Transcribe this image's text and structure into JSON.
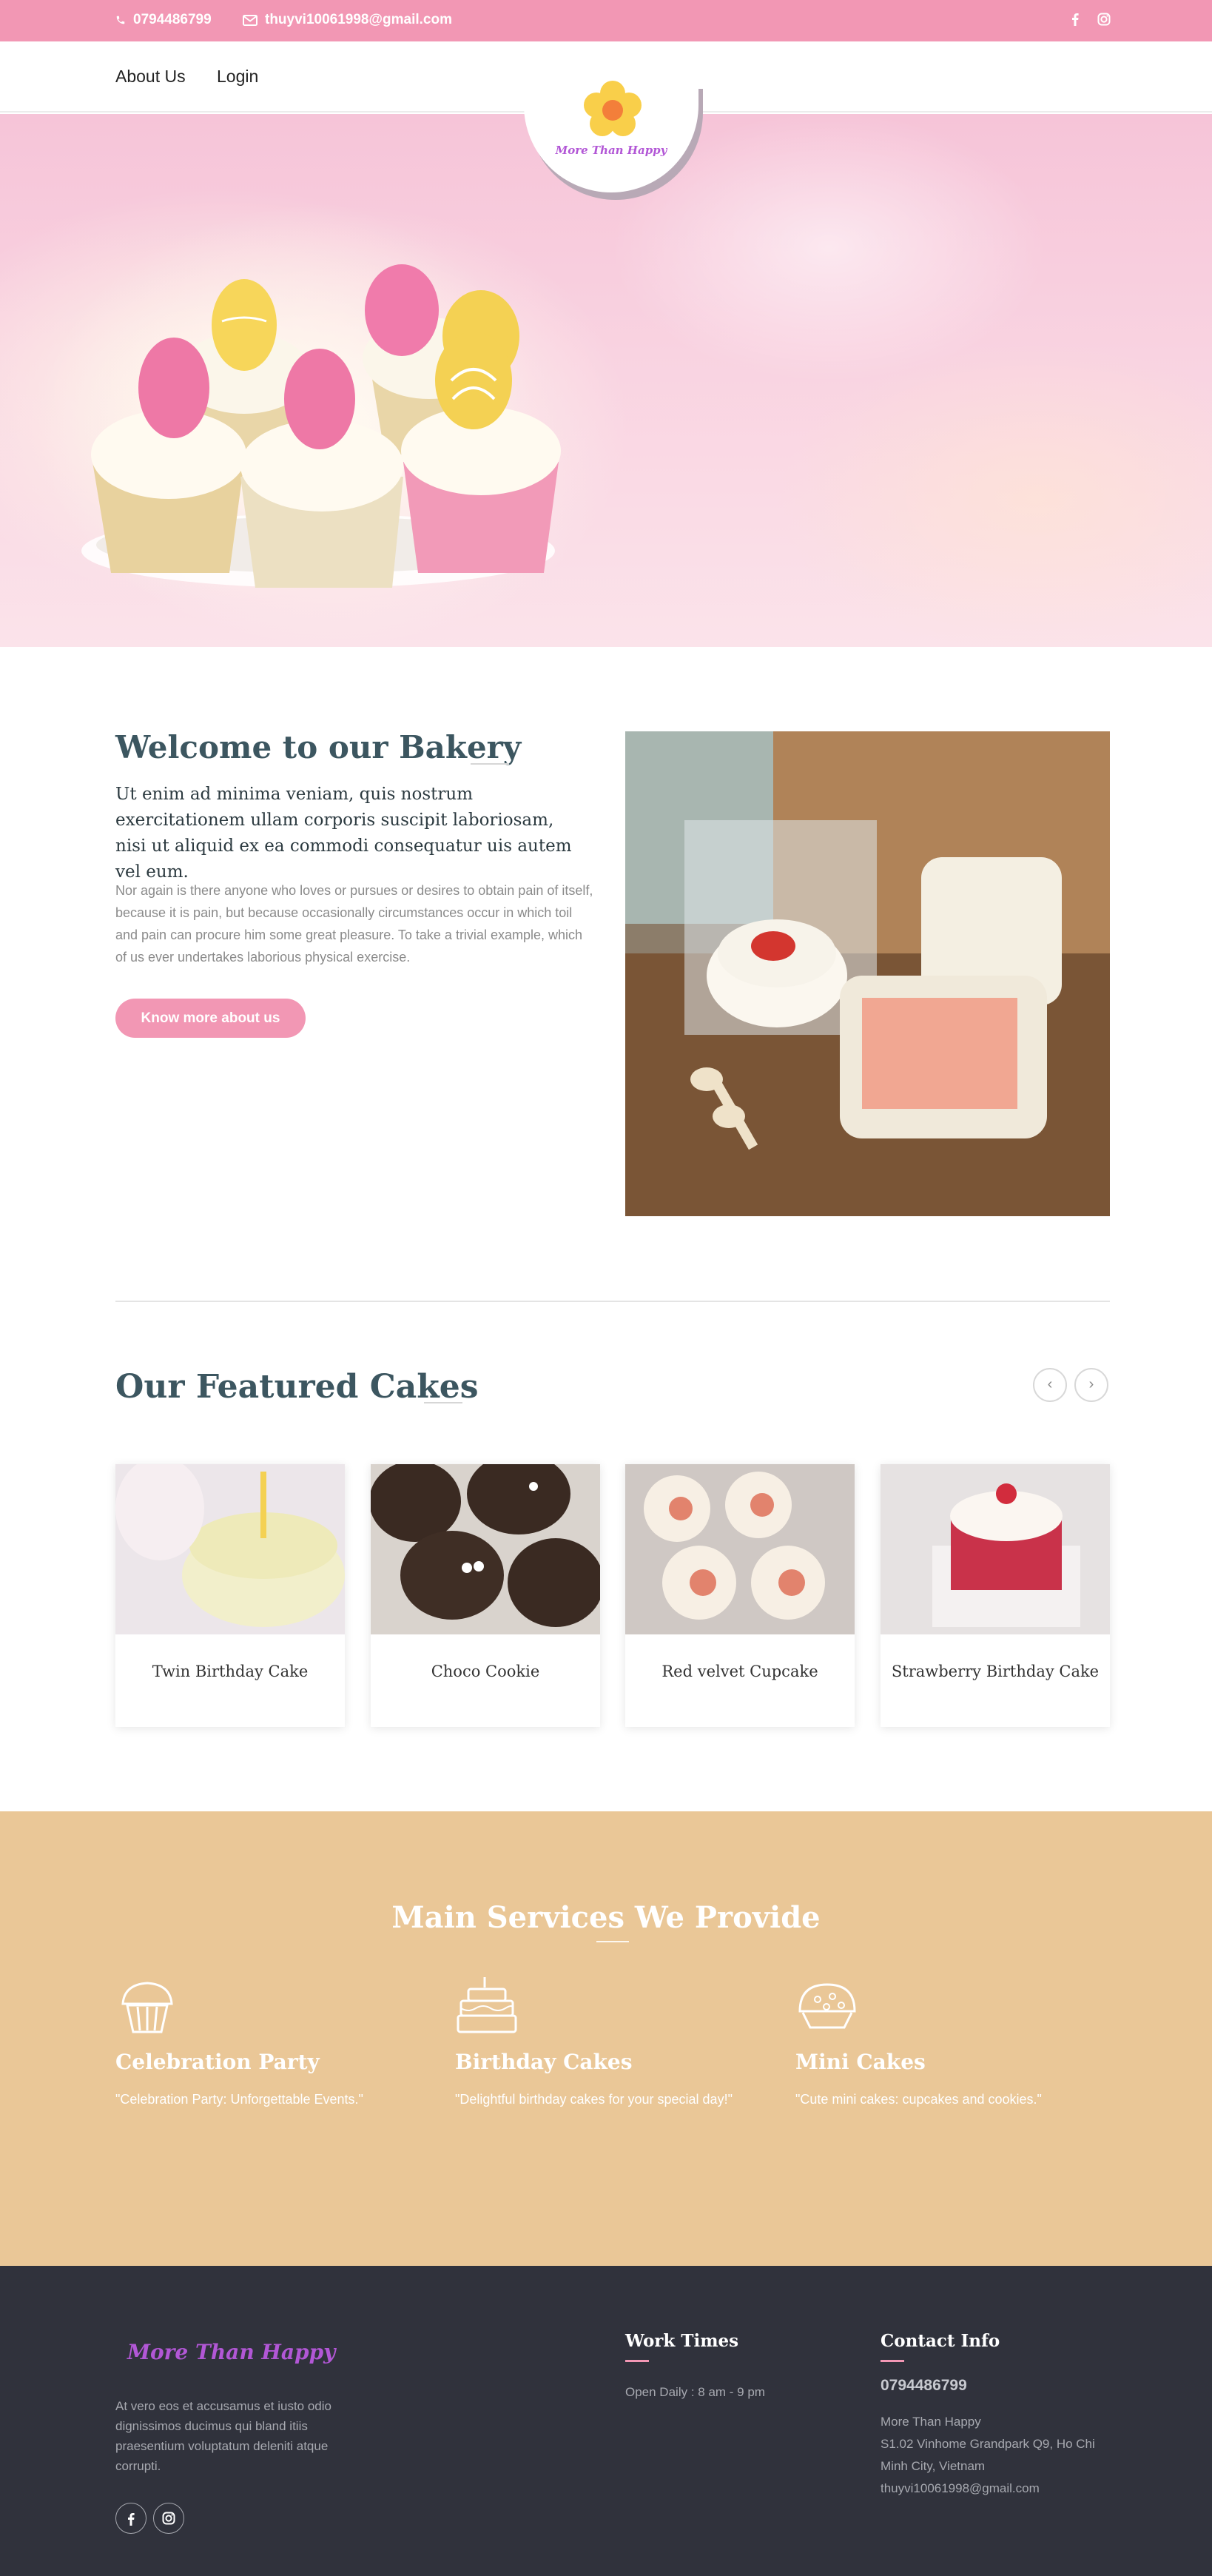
{
  "topbar": {
    "phone": "0794486799",
    "email": "thuyvi10061998@gmail.com",
    "social_icons": [
      "facebook-icon",
      "instagram-icon"
    ]
  },
  "nav": {
    "items": [
      "About Us",
      "Login"
    ],
    "logo_text": "More Than Happy"
  },
  "welcome": {
    "title": "Welcome to our Bakery",
    "lead": "Ut enim ad minima veniam, quis nostrum exercitationem ullam corporis suscipit laboriosam, nisi ut aliquid ex ea commodi consequatur uis autem vel eum.",
    "body": "Nor again is there anyone who loves or pursues or desires to obtain pain of itself, because it is pain, but because occasionally circumstances occur in which toil and pain can procure him some great pleasure. To take a trivial example, which of us ever undertakes laborious physical exercise.",
    "button": "Know more about us"
  },
  "featured": {
    "title": "Our Featured Cakes",
    "prev": "‹",
    "next": "›",
    "cakes": [
      {
        "name": "Twin Birthday Cake"
      },
      {
        "name": "Choco Cookie"
      },
      {
        "name": "Red velvet Cupcake"
      },
      {
        "name": "Strawberry Birthday Cake"
      }
    ]
  },
  "services": {
    "title": "Main Services We Provide",
    "items": [
      {
        "name": "Celebration Party",
        "desc": "\"Celebration Party: Unforgettable Events.\"",
        "icon": "cupcake-icon"
      },
      {
        "name": "Birthday Cakes",
        "desc": "\"Delightful birthday cakes for your special day!\"",
        "icon": "birthday-cake-icon"
      },
      {
        "name": "Mini Cakes",
        "desc": "\"Cute mini cakes: cupcakes and cookies.\"",
        "icon": "pie-icon"
      }
    ]
  },
  "footer": {
    "logo_text": "More Than Happy",
    "about": "At vero eos et accusamus et iusto odio dignissimos ducimus qui bland itiis praesentium voluptatum deleniti atque corrupti.",
    "work_title": "Work Times",
    "work_hours": "Open Daily : 8 am - 9 pm",
    "contact_title": "Contact Info",
    "contact_phone": "0794486799",
    "contact_name": "More Than Happy",
    "contact_address": "S1.02 Vinhome Grandpark Q9, Ho Chi Minh City, Vietnam",
    "contact_email": "thuyvi10061998@gmail.com"
  },
  "colors": {
    "accent_pink": "#f297b4",
    "heading": "#3c5660",
    "services_bg": "#eac797",
    "footer_bg": "#30323c",
    "logo_purple": "#b257d6"
  }
}
